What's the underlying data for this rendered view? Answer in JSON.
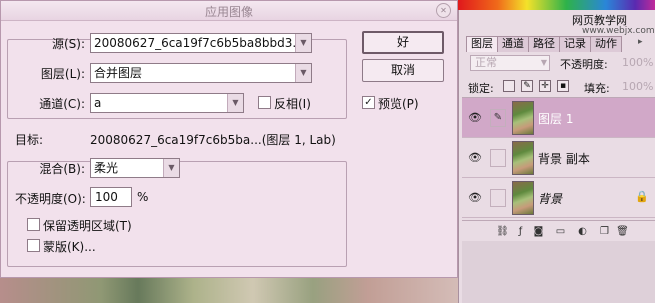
{
  "dialog": {
    "title": "应用图像",
    "source_label": "源(S):",
    "source_value": "20080627_6ca19f7c6b5ba8bbd3...",
    "layer_label": "图层(L):",
    "layer_value": "合并图层",
    "channel_label": "通道(C):",
    "channel_value": "a",
    "invert_label": "反相(I)",
    "invert_checked": false,
    "target_label": "目标:",
    "target_value": "20080627_6ca19f7c6b5ba...(图层 1, Lab)",
    "blend_label": "混合(B):",
    "blend_value": "柔光",
    "opacity_label": "不透明度(O):",
    "opacity_value": "100",
    "opacity_unit": "%",
    "preserve_label": "保留透明区域(T)",
    "preserve_checked": false,
    "mask_label": "蒙版(K)...",
    "mask_checked": false,
    "ok_label": "好",
    "cancel_label": "取消",
    "preview_label": "预览(P)",
    "preview_checked": true
  },
  "watermark": {
    "text": "网页教学网",
    "url": "www.webjx.com"
  },
  "layers_panel": {
    "tabs": [
      "图层",
      "通道",
      "路径",
      "记录",
      "动作"
    ],
    "blend_mode": "正常",
    "opacity_label": "不透明度:",
    "opacity_value": "100%",
    "lock_label": "锁定:",
    "fill_label": "填充:",
    "fill_value": "100%",
    "layers": [
      {
        "name": "图层 1",
        "selected": true,
        "visible": true,
        "locked": false
      },
      {
        "name": "背景 副本",
        "selected": false,
        "visible": true,
        "locked": false
      },
      {
        "name": "背景",
        "selected": false,
        "visible": true,
        "locked": true
      }
    ],
    "footer_icons": [
      "link-layers-icon",
      "layer-style-icon",
      "layer-mask-icon",
      "new-group-icon",
      "adjustment-layer-icon",
      "new-layer-icon",
      "delete-layer-icon"
    ]
  }
}
